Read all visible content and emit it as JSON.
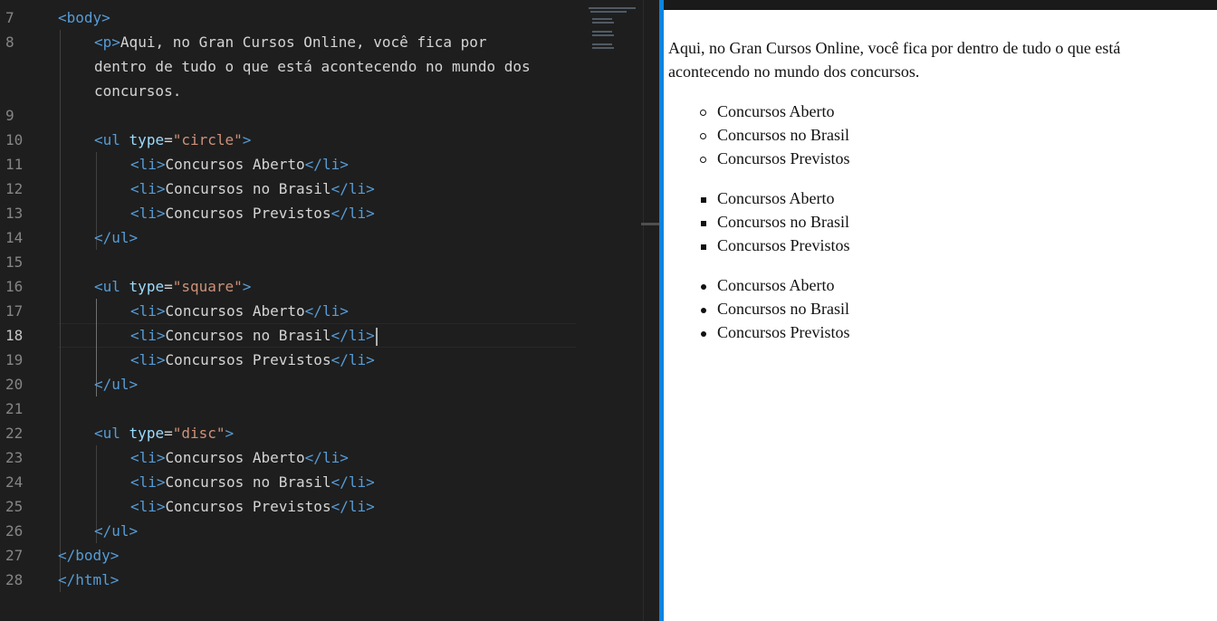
{
  "editor": {
    "line_numbers": [
      "7",
      "8",
      "",
      "",
      "9",
      "10",
      "11",
      "12",
      "13",
      "14",
      "15",
      "16",
      "17",
      "18",
      "19",
      "20",
      "21",
      "22",
      "23",
      "24",
      "25",
      "26",
      "27",
      "28"
    ],
    "active_line_number": "18",
    "code": {
      "l7_open": "<",
      "l7_tag": "body",
      "l7_close": ">",
      "l8_tag_open": "<",
      "l8_tag": "p",
      "l8_tag_close": ">",
      "l8_text": "Aqui, no Gran Cursos Online, você fica por",
      "l8_wrap1": "dentro de tudo o que está acontecendo no mundo dos",
      "l8_wrap2": "concursos.",
      "ul_open": "<",
      "ul_tag": "ul",
      "ul_attr": "type",
      "ul_eq": "=",
      "ul1_value": "\"circle\"",
      "ul2_value": "\"square\"",
      "ul3_value": "\"disc\"",
      "gt": ">",
      "li_open": "<",
      "li_tag": "li",
      "li_close_open": "</",
      "ul_close_open": "</",
      "ul_close_tag": "ul",
      "item1": "Concursos Aberto",
      "item2": "Concursos no Brasil",
      "item3": "Concursos Previstos",
      "body_close_open": "</",
      "body_close_tag": "body",
      "html_close_tag": "html"
    }
  },
  "preview": {
    "paragraph": "Aqui, no Gran Cursos Online, você fica por dentro de tudo o que está acontecendo no mundo dos concursos.",
    "lists": [
      {
        "bullet": "circle",
        "items": [
          "Concursos Aberto",
          "Concursos no Brasil",
          "Concursos Previstos"
        ]
      },
      {
        "bullet": "square",
        "items": [
          "Concursos Aberto",
          "Concursos no Brasil",
          "Concursos Previstos"
        ]
      },
      {
        "bullet": "disc",
        "items": [
          "Concursos Aberto",
          "Concursos no Brasil",
          "Concursos Previstos"
        ]
      }
    ]
  },
  "colors": {
    "editor_bg": "#1e1e1e",
    "tag": "#569cd6",
    "attribute": "#9cdcfe",
    "string": "#ce9178",
    "text": "#d4d4d4",
    "line_number": "#858585",
    "divider": "#0a84e0",
    "preview_bg": "#ffffff"
  }
}
